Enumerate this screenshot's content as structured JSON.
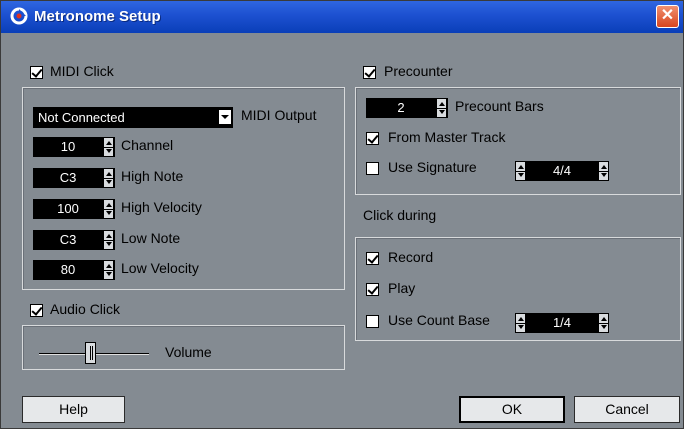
{
  "window": {
    "title": "Metronome Setup",
    "close_label": "✕"
  },
  "midi_click": {
    "label": "MIDI Click",
    "checked": true,
    "output_value": "Not Connected",
    "output_label": "MIDI Output",
    "fields": [
      {
        "value": "10",
        "label": "Channel"
      },
      {
        "value": "C3",
        "label": "High Note"
      },
      {
        "value": "100",
        "label": "High Velocity"
      },
      {
        "value": "C3",
        "label": "Low Note"
      },
      {
        "value": "80",
        "label": "Low Velocity"
      }
    ]
  },
  "audio_click": {
    "label": "Audio Click",
    "checked": true,
    "volume_label": "Volume"
  },
  "precounter": {
    "label": "Precounter",
    "checked": true,
    "bars_value": "2",
    "bars_label": "Precount Bars",
    "from_master_label": "From Master Track",
    "from_master_checked": true,
    "use_signature_label": "Use Signature",
    "use_signature_checked": false,
    "signature_value": "4/4"
  },
  "click_during": {
    "label": "Click during",
    "record_label": "Record",
    "record_checked": true,
    "play_label": "Play",
    "play_checked": true,
    "count_base_label": "Use Count Base",
    "count_base_checked": false,
    "count_base_value": "1/4"
  },
  "buttons": {
    "help": "Help",
    "ok": "OK",
    "cancel": "Cancel"
  }
}
